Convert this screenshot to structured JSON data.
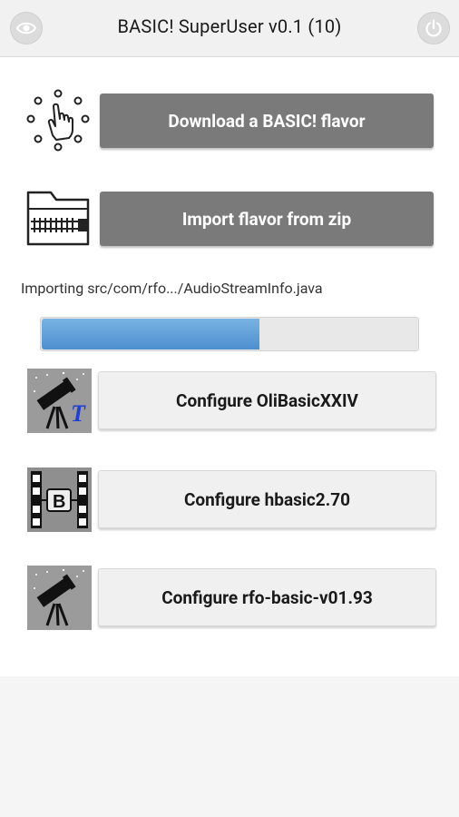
{
  "header": {
    "title": "BASIC! SuperUser v0.1 (10)",
    "left_icon": "eye-icon",
    "right_icon": "power-icon"
  },
  "actions": {
    "download_label": "Download a BASIC! flavor",
    "download_icon": "tap-hand-icon",
    "import_label": "Import flavor from zip",
    "import_icon": "zip-folder-icon"
  },
  "import_status": {
    "text": "Importing src/com/rfo.../AudioStreamInfo.java",
    "progress": 0.58
  },
  "flavors": [
    {
      "label": "Configure OliBasicXXIV",
      "icon": "telescope-t-icon"
    },
    {
      "label": "Configure hbasic2.70",
      "icon": "hbasic-b-icon"
    },
    {
      "label": "Configure rfo-basic-v01.93",
      "icon": "telescope-icon"
    }
  ],
  "colors": {
    "dark_button": "#7a7a7a",
    "light_button": "#f0f0f0",
    "progress_fill": "#4d8fcf",
    "header_bg": "#f1f1f1"
  }
}
